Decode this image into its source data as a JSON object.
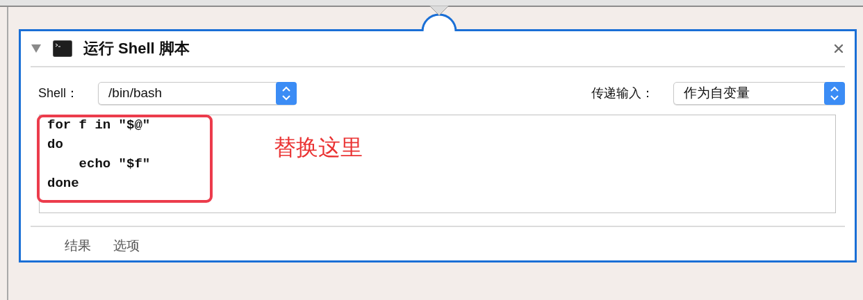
{
  "action": {
    "title": "运行 Shell 脚本",
    "expanded": true
  },
  "shell": {
    "label": "Shell：",
    "value": "/bin/bash"
  },
  "input": {
    "label": "传递输入：",
    "value": "作为自变量"
  },
  "script": {
    "code": "for f in \"$@\"\ndo\n    echo \"$f\"\ndone"
  },
  "annotation": {
    "text": "替换这里"
  },
  "tabs": [
    {
      "label": "结果",
      "selected": false
    },
    {
      "label": "选项",
      "selected": false
    }
  ]
}
